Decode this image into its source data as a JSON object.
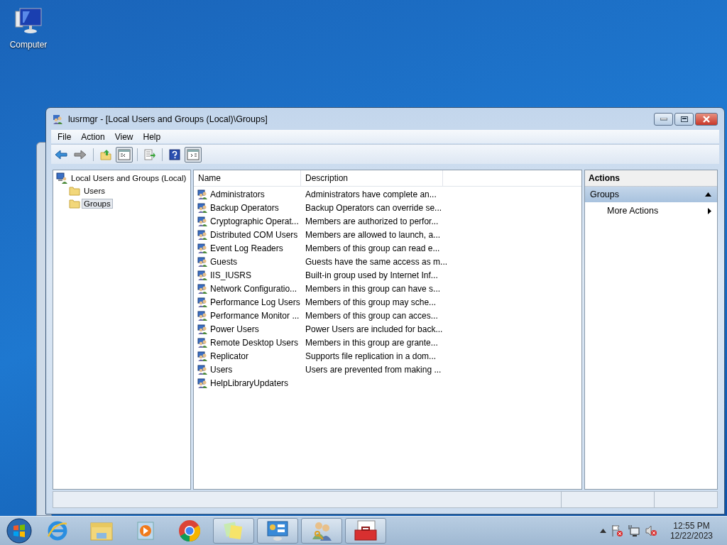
{
  "desktop_icons": [
    {
      "label": "Computer"
    }
  ],
  "window": {
    "title": "lusrmgr - [Local Users and Groups (Local)\\Groups]"
  },
  "menu": [
    "File",
    "Action",
    "View",
    "Help"
  ],
  "toolbar": [
    {
      "kind": "back",
      "pressed": false
    },
    {
      "kind": "forward",
      "pressed": false
    },
    {
      "kind": "sep"
    },
    {
      "kind": "up",
      "pressed": false
    },
    {
      "kind": "tree",
      "pressed": true
    },
    {
      "kind": "sep"
    },
    {
      "kind": "export",
      "pressed": false
    },
    {
      "kind": "sep"
    },
    {
      "kind": "help",
      "pressed": false
    },
    {
      "kind": "actionpane",
      "pressed": true
    }
  ],
  "tree": {
    "label": "Local Users and Groups (Local)",
    "expanded": true,
    "selected": false,
    "children": [
      {
        "label": "Users",
        "selected": false
      },
      {
        "label": "Groups",
        "selected": true
      }
    ]
  },
  "table": {
    "columns": [
      "Name",
      "Description"
    ],
    "rows": [
      {
        "name": "Administrators",
        "description": "Administrators have complete an..."
      },
      {
        "name": "Backup Operators",
        "description": "Backup Operators can override se..."
      },
      {
        "name": "Cryptographic Operat...",
        "description": "Members are authorized to perfor..."
      },
      {
        "name": "Distributed COM Users",
        "description": "Members are allowed to launch, a..."
      },
      {
        "name": "Event Log Readers",
        "description": "Members of this group can read e..."
      },
      {
        "name": "Guests",
        "description": "Guests have the same access as m..."
      },
      {
        "name": "IIS_IUSRS",
        "description": "Built-in group used by Internet Inf..."
      },
      {
        "name": "Network Configuratio...",
        "description": "Members in this group can have s..."
      },
      {
        "name": "Performance Log Users",
        "description": "Members of this group may sche..."
      },
      {
        "name": "Performance Monitor ...",
        "description": "Members of this group can acces..."
      },
      {
        "name": "Power Users",
        "description": "Power Users are included for back..."
      },
      {
        "name": "Remote Desktop Users",
        "description": "Members in this group are grante..."
      },
      {
        "name": "Replicator",
        "description": "Supports file replication in a dom..."
      },
      {
        "name": "Users",
        "description": "Users are prevented from making ..."
      },
      {
        "name": "HelpLibraryUpdaters"
      }
    ]
  },
  "actions": {
    "title": "Actions",
    "sections": [
      {
        "label": "Groups",
        "expanded": true,
        "items": [
          {
            "label": "More Actions",
            "submenu": true
          }
        ]
      }
    ]
  },
  "taskbar": {
    "apps": [
      {
        "kind": "ie",
        "running": false
      },
      {
        "kind": "explorer",
        "running": false
      },
      {
        "kind": "media",
        "running": false
      },
      {
        "kind": "chrome",
        "running": false
      },
      {
        "kind": "notes",
        "running": true
      },
      {
        "kind": "control",
        "running": true
      },
      {
        "kind": "users",
        "running": true
      },
      {
        "kind": "toolbox",
        "running": true
      }
    ],
    "clock": {
      "time": "12:55 PM",
      "date": "12/22/2023"
    }
  }
}
